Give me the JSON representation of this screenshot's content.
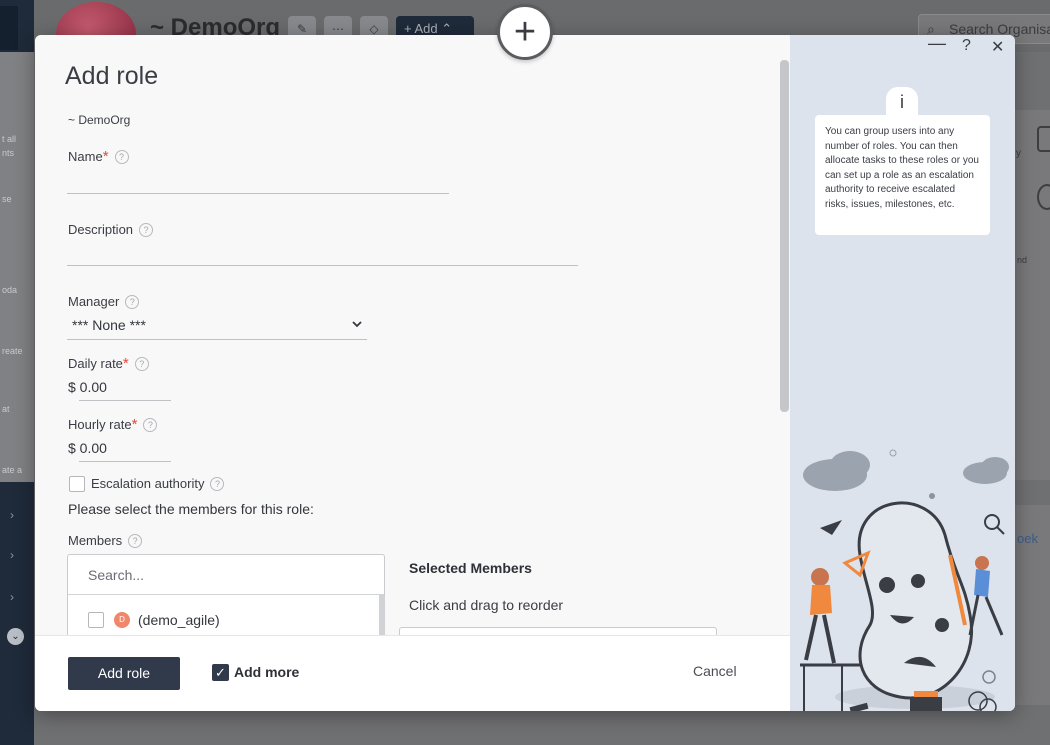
{
  "background": {
    "org_title": "~ DemoOrg",
    "add_button": "Add",
    "search_placeholder": "Search Organisa",
    "left_fragments": [
      "t all",
      "nts",
      "se",
      "oda",
      "reate",
      "at",
      "ate a"
    ],
    "right_fragment": "oek",
    "right_fragment_2": "y",
    "right_fragment_3": "nd"
  },
  "modal": {
    "title": "Add role",
    "org": "~ DemoOrg",
    "fields": {
      "name": {
        "label": "Name",
        "value": ""
      },
      "description": {
        "label": "Description",
        "value": ""
      },
      "manager": {
        "label": "Manager",
        "value": "*** None ***"
      },
      "daily_rate": {
        "label": "Daily rate",
        "value": "$ 0.00"
      },
      "hourly_rate": {
        "label": "Hourly rate",
        "value": "$ 0.00"
      },
      "escalation": {
        "label": "Escalation authority",
        "checked": false
      }
    },
    "members_instruction": "Please select the members for this role:",
    "members": {
      "label": "Members",
      "search_placeholder": "Search...",
      "items": [
        {
          "badge": "D",
          "name": "(demo_agile)",
          "checked": false
        }
      ]
    },
    "selected": {
      "title": "Selected Members",
      "subtitle": "Click and drag to reorder"
    },
    "footer": {
      "add_role": "Add role",
      "add_more": "Add more",
      "add_more_checked": true,
      "cancel": "Cancel"
    },
    "window_controls": {
      "minimize": "—",
      "help": "?",
      "close": "✕"
    },
    "info": {
      "icon": "i",
      "text": "You can group users into any number of roles. You can then allocate tasks to these roles or you can set up a role as an escalation authority to receive escalated risks, issues, milestones, etc."
    }
  }
}
